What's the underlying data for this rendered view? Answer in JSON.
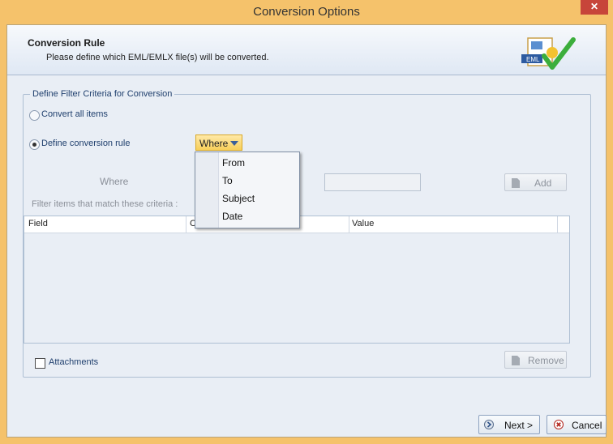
{
  "window": {
    "title": "Conversion Options",
    "close_glyph": "✕"
  },
  "header": {
    "title": "Conversion Rule",
    "subtitle": "Please define which EML/EMLX file(s) will be converted.",
    "logo_text": "EML"
  },
  "filter": {
    "legend": "Define Filter Criteria for Conversion",
    "radio_all": "Convert all items",
    "radio_rule": "Define conversion rule",
    "where_dropdown": "Where",
    "where_label": "Where",
    "criteria_label": "Filter items that match these criteria :",
    "add_button": "Add"
  },
  "menu": {
    "items": [
      "From",
      "To",
      "Subject",
      "Date"
    ]
  },
  "grid": {
    "columns": [
      "Field",
      "C",
      "Value"
    ]
  },
  "attachments_label": "Attachments",
  "remove_button": "Remove",
  "footer": {
    "next": "Next >",
    "cancel": "Cancel"
  },
  "colors": {
    "frame": "#f5c26b",
    "panel": "#e9eef5",
    "accent": "#1f3f6d"
  }
}
